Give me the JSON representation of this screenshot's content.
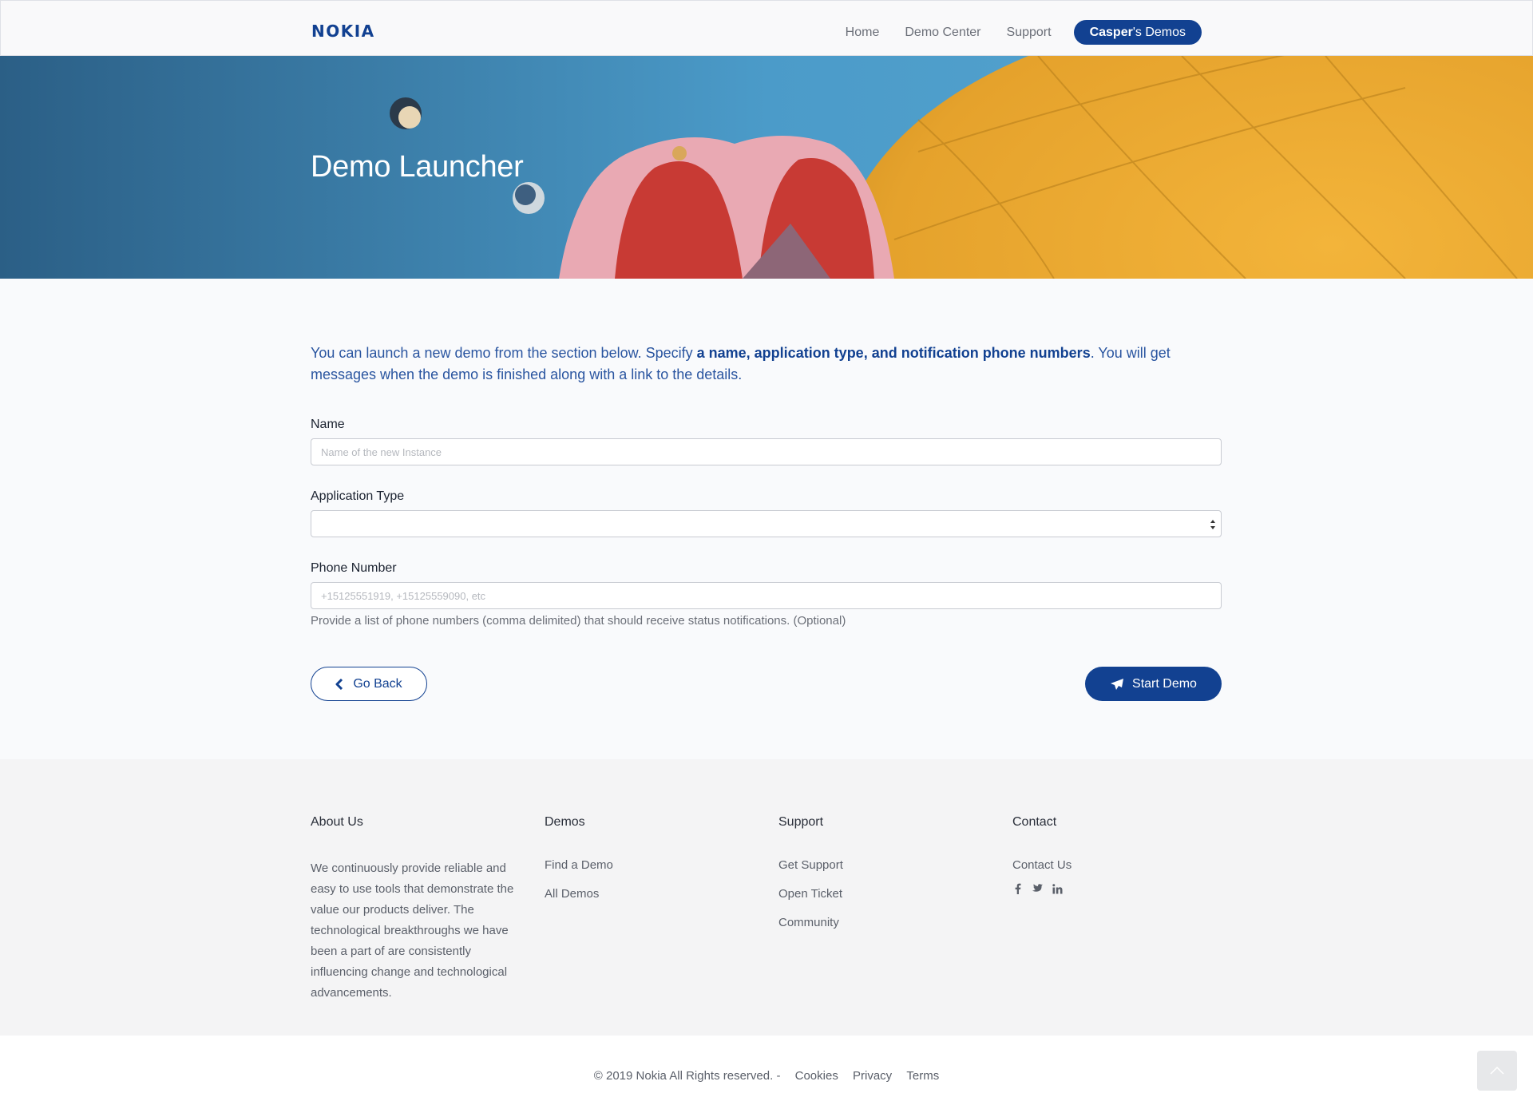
{
  "header": {
    "brand": "NOKIA",
    "nav": [
      {
        "label": "Home"
      },
      {
        "label": "Demo Center"
      },
      {
        "label": "Support"
      }
    ],
    "user_pill": {
      "name": "Casper",
      "suffix": "'s Demos"
    }
  },
  "hero": {
    "title": "Demo Launcher"
  },
  "intro": {
    "lead": "You can launch a new demo from the section below. Specify ",
    "emphasis": "a name, application type, and notification phone numbers",
    "tail": ". You will get messages when the demo is finished along with a link to the details."
  },
  "form": {
    "name": {
      "label": "Name",
      "placeholder": "Name of the new Instance",
      "value": ""
    },
    "app_type": {
      "label": "Application Type",
      "selected": ""
    },
    "phone": {
      "label": "Phone Number",
      "placeholder": "+15125551919, +15125559090, etc",
      "value": "",
      "help": "Provide a list of phone numbers (comma delimited) that should receive status notifications. (Optional)"
    },
    "back_label": "Go Back",
    "start_label": "Start Demo"
  },
  "footer": {
    "about": {
      "title": "About Us",
      "text": "We continuously provide reliable and easy to use tools that demonstrate the value our products deliver. The technological breakthroughs we have been a part of are consistently influencing change and technological advancements."
    },
    "demos": {
      "title": "Demos",
      "links": [
        "Find a Demo",
        "All Demos"
      ]
    },
    "support": {
      "title": "Support",
      "links": [
        "Get Support",
        "Open Ticket",
        "Community"
      ]
    },
    "contact": {
      "title": "Contact",
      "links": [
        "Contact Us"
      ],
      "social": [
        "facebook-icon",
        "twitter-icon",
        "linkedin-icon"
      ]
    }
  },
  "bottom": {
    "copyright": "© 2019 Nokia All Rights reserved. -",
    "links": [
      "Cookies",
      "Privacy",
      "Terms"
    ]
  },
  "colors": {
    "brand": "#124191",
    "footer_bg": "#f4f4f5",
    "page_bg": "#f9fafc"
  }
}
